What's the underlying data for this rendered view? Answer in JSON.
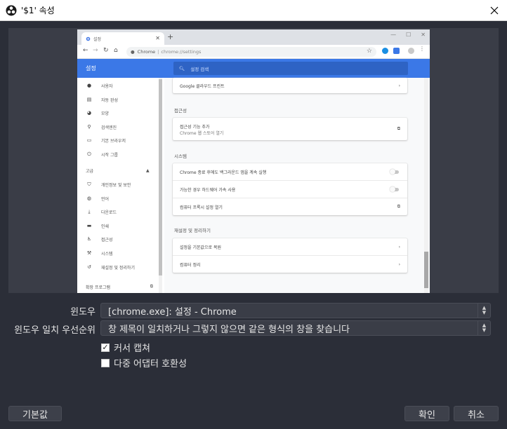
{
  "titlebar": {
    "title": "'$1' 속성"
  },
  "preview": {
    "tab_title": "설정",
    "omnibox_site": "Chrome",
    "omnibox_url": "chrome://settings",
    "settings_title": "설정",
    "search_placeholder": "설정 검색",
    "sidebar": {
      "items": [
        {
          "icon": "person-icon",
          "label": "사용자"
        },
        {
          "icon": "autofill-icon",
          "label": "자동 완성"
        },
        {
          "icon": "palette-icon",
          "label": "모양"
        },
        {
          "icon": "search-icon",
          "label": "검색엔진"
        },
        {
          "icon": "browser-icon",
          "label": "기본 브라우저"
        },
        {
          "icon": "power-icon",
          "label": "시작 그룹"
        }
      ],
      "advanced_label": "고급",
      "advanced_items": [
        {
          "icon": "shield-icon",
          "label": "개인정보 및 보안"
        },
        {
          "icon": "globe-icon",
          "label": "언어"
        },
        {
          "icon": "download-icon",
          "label": "다운로드"
        },
        {
          "icon": "print-icon",
          "label": "인쇄"
        },
        {
          "icon": "accessibility-icon",
          "label": "접근성"
        },
        {
          "icon": "wrench-icon",
          "label": "시스템"
        },
        {
          "icon": "reset-icon",
          "label": "재설정 및 정리하기"
        }
      ],
      "extensions_label": "확장 프로그램"
    },
    "content": {
      "top_row": "Google 클라우드 프린트",
      "accessibility_title": "접근성",
      "accessibility_row_title": "접근성 기능 추가",
      "accessibility_row_sub": "Chrome 웹 스토어 열기",
      "system_title": "시스템",
      "system_rows": [
        "Chrome 종료 후에도 백그라운드 앱을 계속 실행",
        "가능한 경우 하드웨어 가속 사용",
        "컴퓨터 프록시 설정 열기"
      ],
      "reset_title": "재설정 및 정리하기",
      "reset_rows": [
        "설정을 기본값으로 복원",
        "컴퓨터 정리"
      ]
    }
  },
  "form": {
    "window_label": "윈도우",
    "window_value": "[chrome.exe]: 설정 - Chrome",
    "priority_label": "윈도우 일치 우선순위",
    "priority_value": "창 제목이 일치하거나 그렇지 않으면 같은 형식의 창을 찾습니다",
    "capture_cursor_label": "커서 캡쳐",
    "capture_cursor_checked": true,
    "multi_adapter_label": "다중 어댑터 호환성",
    "multi_adapter_checked": false
  },
  "buttons": {
    "defaults": "기본값",
    "ok": "확인",
    "cancel": "취소"
  },
  "colors": {
    "dialog_bg": "#2b2e38",
    "chrome_accent": "#3b78e7"
  }
}
